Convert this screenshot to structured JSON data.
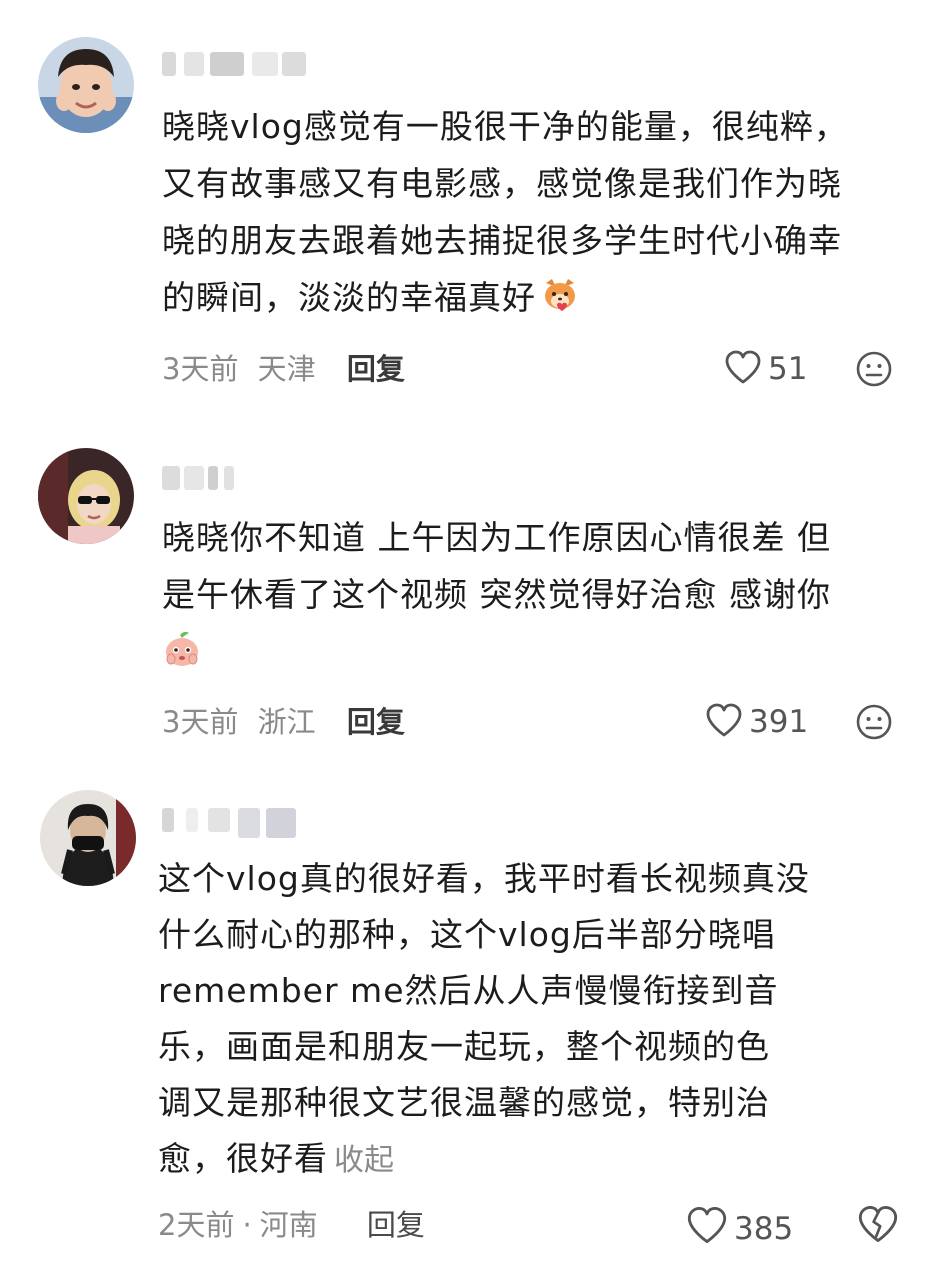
{
  "comments": [
    {
      "lines": [
        "晓晓vlog感觉有一股很干净的能量，很纯粹，",
        "又有故事感又有电影感，感觉像是我们作为晓",
        "晓的朋友去跟着她去捕捉很多学生时代小确幸",
        "的瞬间，淡淡的幸福真好"
      ],
      "emoji": "fox-heart-emoji",
      "time": "3天前",
      "location": "天津",
      "reply_label": "回复",
      "likes": "51"
    },
    {
      "lines": [
        "晓晓你不知道 上午因为工作原因心情很差 但",
        "是午休看了这个视频 突然觉得好治愈 感谢你"
      ],
      "emoji": "peach-teary-emoji",
      "time": "3天前",
      "location": "浙江",
      "reply_label": "回复",
      "likes": "391"
    },
    {
      "lines": [
        "这个vlog真的很好看，我平时看长视频真没",
        "什么耐心的那种，这个vlog后半部分晓唱",
        "remember me然后从人声慢慢衔接到音",
        "乐，画面是和朋友一起玩，整个视频的色",
        "调又是那种很文艺很温馨的感觉，特别治",
        "愈，很好看"
      ],
      "collapse_label": "收起",
      "time": "2天前",
      "separator": "·",
      "location": "河南",
      "reply_label": "回复",
      "likes": "385"
    }
  ],
  "icons": {
    "like": "heart-outline-icon",
    "dislike_1": "neutral-face-icon",
    "dislike_2": "broken-heart-icon"
  },
  "colors": {
    "text": "#1c1c1c",
    "meta": "#8a8a8a",
    "reply": "#3a3a3a"
  }
}
